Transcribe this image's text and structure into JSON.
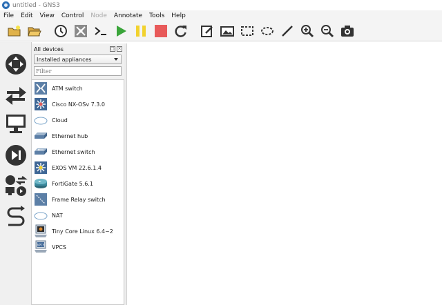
{
  "window": {
    "title": "untitled - GNS3"
  },
  "menu": [
    {
      "label": "File",
      "enabled": true
    },
    {
      "label": "Edit",
      "enabled": true
    },
    {
      "label": "View",
      "enabled": true
    },
    {
      "label": "Control",
      "enabled": true
    },
    {
      "label": "Node",
      "enabled": false
    },
    {
      "label": "Annotate",
      "enabled": true
    },
    {
      "label": "Tools",
      "enabled": true
    },
    {
      "label": "Help",
      "enabled": true
    }
  ],
  "toolbar": [
    {
      "icon": "new-project-icon"
    },
    {
      "icon": "open-project-icon"
    },
    {
      "icon": "snapshot-clock-icon"
    },
    {
      "icon": "show-interface-labels-icon"
    },
    {
      "icon": "console-icon"
    },
    {
      "icon": "start-icon"
    },
    {
      "icon": "pause-icon"
    },
    {
      "icon": "stop-icon"
    },
    {
      "icon": "reload-icon"
    },
    {
      "icon": "add-note-icon"
    },
    {
      "icon": "insert-picture-icon"
    },
    {
      "icon": "draw-rectangle-icon"
    },
    {
      "icon": "draw-ellipse-icon"
    },
    {
      "icon": "draw-line-icon"
    },
    {
      "icon": "zoom-in-icon"
    },
    {
      "icon": "zoom-out-icon"
    },
    {
      "icon": "screenshot-icon"
    }
  ],
  "leftbar": [
    {
      "icon": "browse-routers-icon"
    },
    {
      "icon": "browse-switches-icon"
    },
    {
      "icon": "browse-end-devices-icon"
    },
    {
      "icon": "browse-security-devices-icon"
    },
    {
      "icon": "browse-all-devices-icon"
    },
    {
      "icon": "add-link-icon"
    }
  ],
  "dock": {
    "title": "All devices",
    "filter_select": "Installed appliances",
    "filter_placeholder": "Filter",
    "devices": [
      {
        "label": "ATM switch",
        "icon": "atm-switch-icon"
      },
      {
        "label": "Cisco NX-OSv 7.3.0",
        "icon": "cisco-nxosv-icon"
      },
      {
        "label": "Cloud",
        "icon": "cloud-icon"
      },
      {
        "label": "Ethernet hub",
        "icon": "ethernet-hub-icon"
      },
      {
        "label": "Ethernet switch",
        "icon": "ethernet-switch-icon"
      },
      {
        "label": "EXOS VM 22.6.1.4",
        "icon": "exos-vm-icon"
      },
      {
        "label": "FortiGate 5.6.1",
        "icon": "fortigate-icon"
      },
      {
        "label": "Frame Relay switch",
        "icon": "frame-relay-switch-icon"
      },
      {
        "label": "NAT",
        "icon": "nat-icon"
      },
      {
        "label": "Tiny Core Linux 6.4~2",
        "icon": "tiny-core-linux-icon"
      },
      {
        "label": "VPCS",
        "icon": "vpcs-icon",
        "icon_text": "VPCS"
      }
    ]
  }
}
